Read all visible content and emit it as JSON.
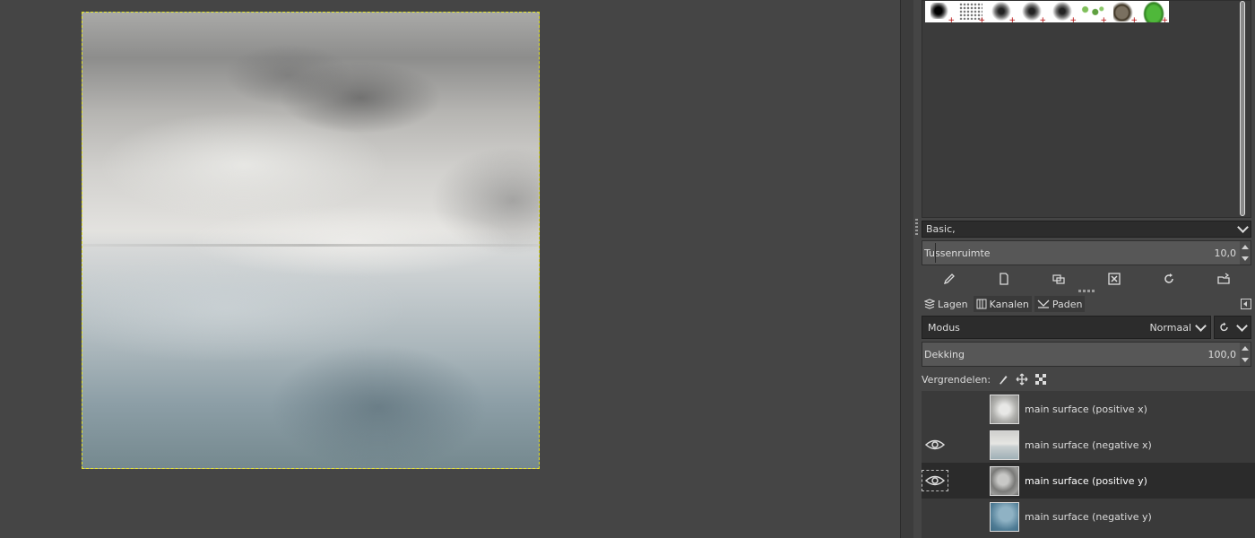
{
  "brushes": {
    "preset_select": "Basic,",
    "spacing_label": "Tussenruimte",
    "spacing_value": "10,0"
  },
  "layers_panel": {
    "tabs": [
      {
        "label": "Lagen",
        "active": true
      },
      {
        "label": "Kanalen",
        "active": false
      },
      {
        "label": "Paden",
        "active": false
      }
    ],
    "mode_label": "Modus",
    "mode_value": "Normaal",
    "opacity_label": "Dekking",
    "opacity_value": "100,0",
    "lock_label": "Vergrendelen:",
    "layers": [
      {
        "name": "main surface (positive x)",
        "visible": false,
        "selected": false
      },
      {
        "name": "main surface (negative x)",
        "visible": true,
        "selected": false
      },
      {
        "name": "main surface (positive y)",
        "visible": true,
        "selected": true
      },
      {
        "name": "main surface (negative y)",
        "visible": false,
        "selected": false
      }
    ]
  },
  "colors": {
    "selection_border": "#e6e62a",
    "panel_bg": "#454545",
    "selected_row": "#2b2b2b"
  }
}
